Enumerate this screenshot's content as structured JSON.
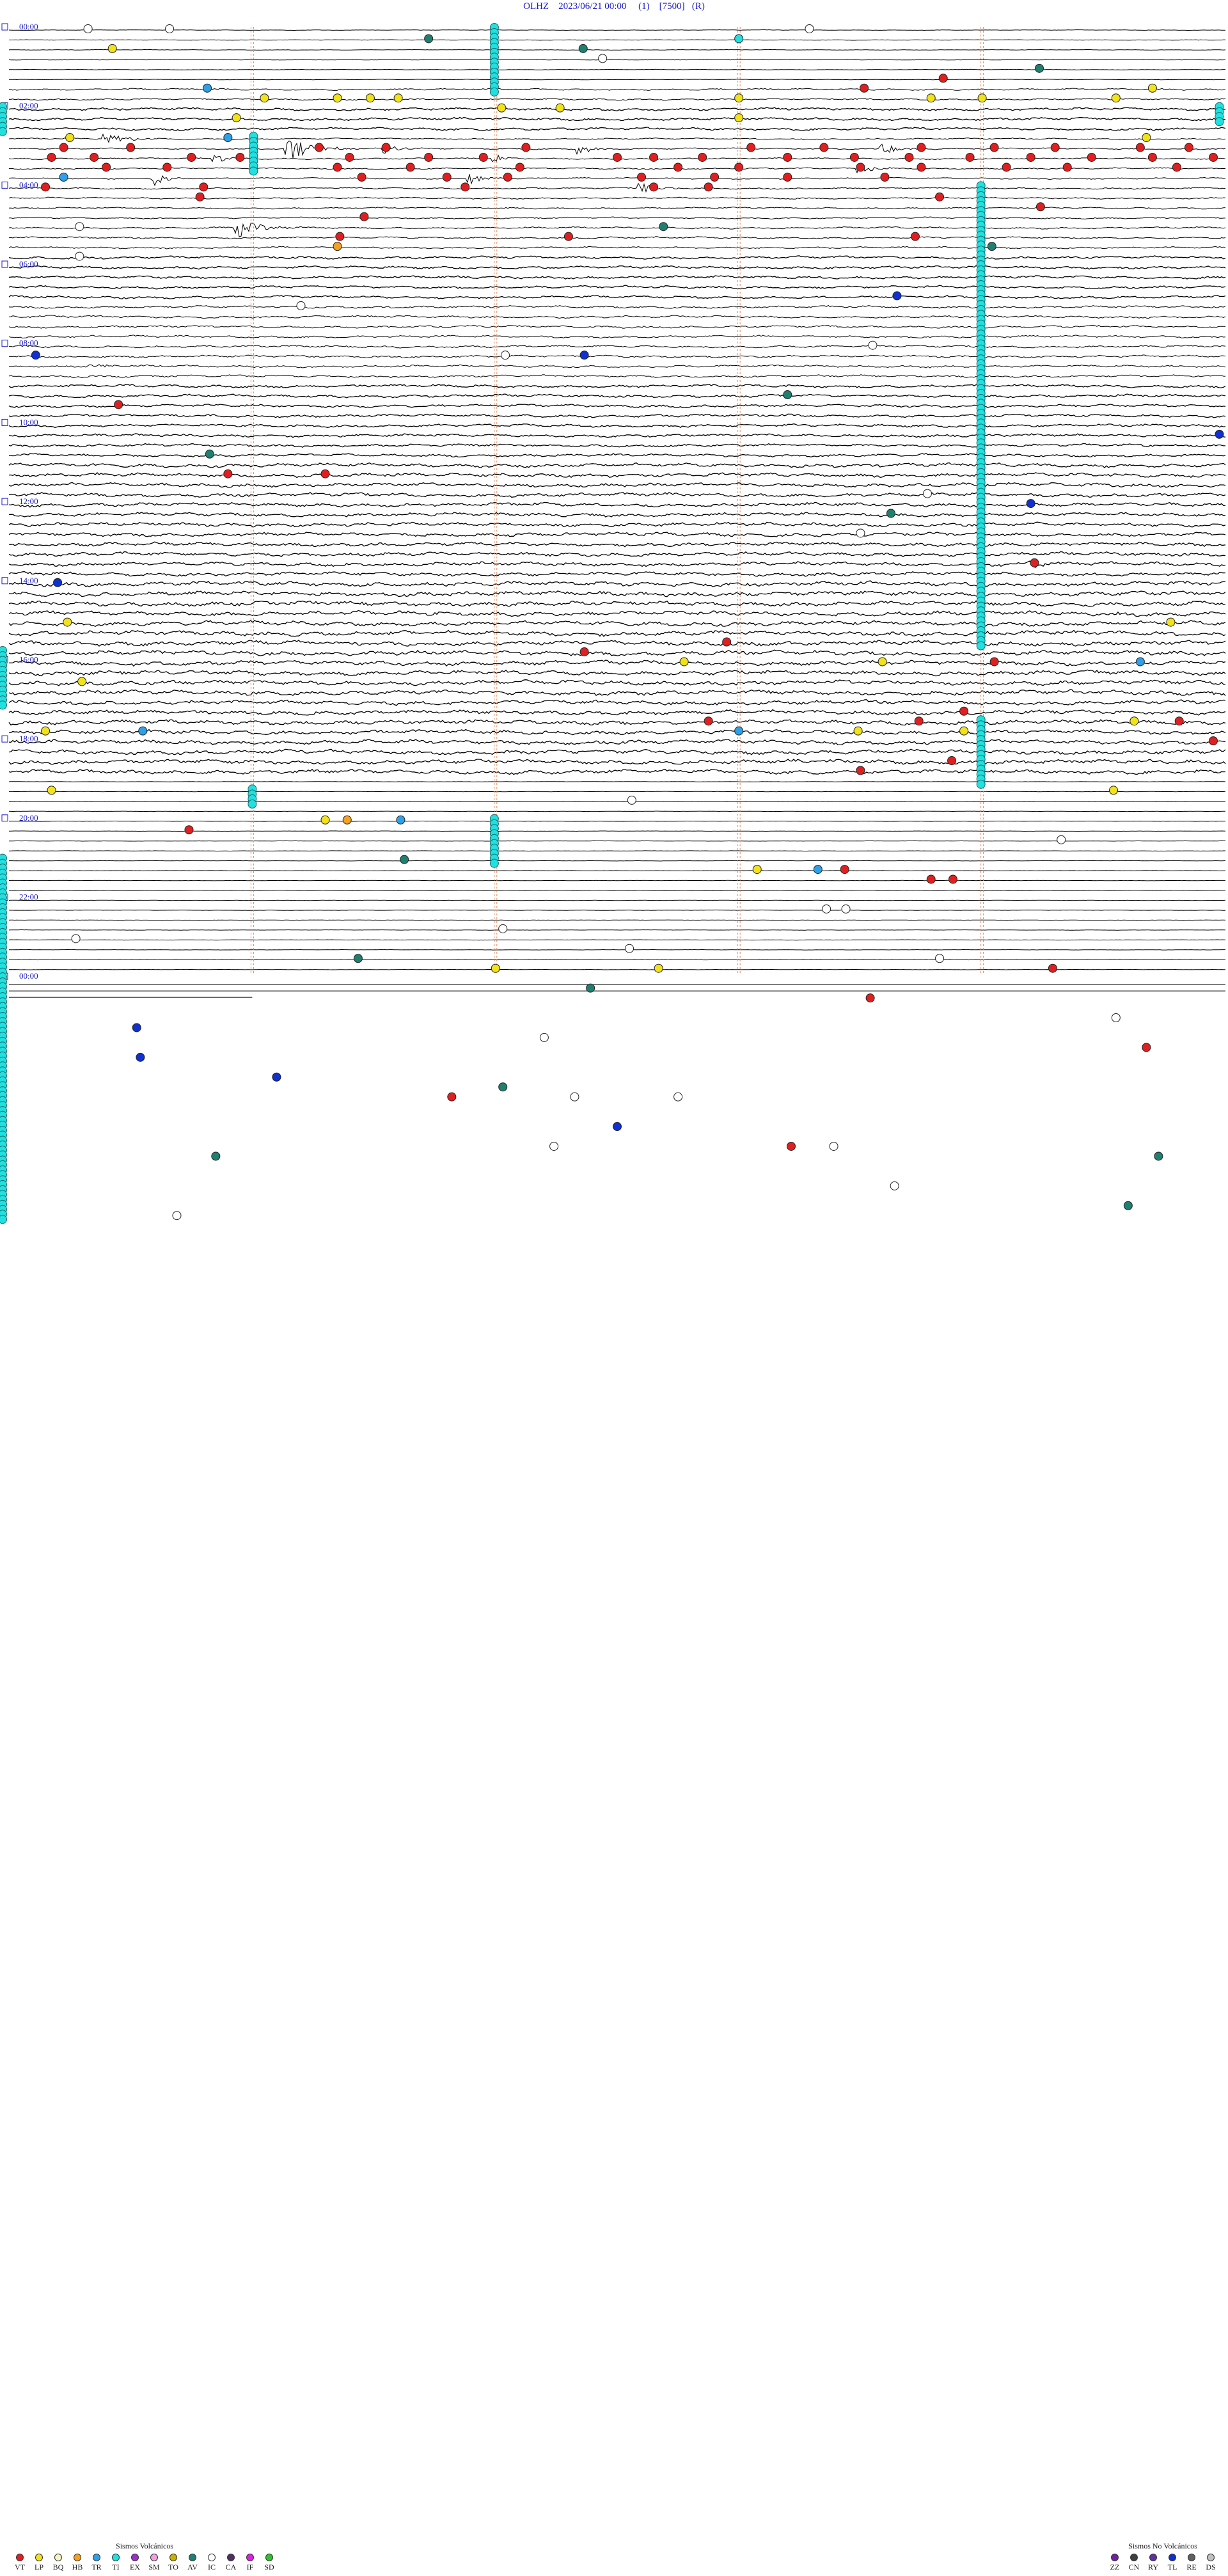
{
  "header": {
    "station": "OLHZ",
    "datetime": "2023/06/21 00:00",
    "run": "(1)",
    "scale": "[7500]",
    "flag": "(R)"
  },
  "colors": {
    "title_blue": "#1a1acc",
    "trace": "#000000",
    "marker_line": "#e8895a",
    "VT": "#e02020",
    "LP": "#f2e21a",
    "BQ": "#f7f4c0",
    "HB": "#f5a020",
    "TR": "#2ea0e8",
    "TI": "#20e0e0",
    "EX": "#9a30c8",
    "SM": "#f0a0e0",
    "TO": "#c8b000",
    "AV": "#208070",
    "IC": "#ffffff",
    "CA": "#503060",
    "IF": "#e020e0",
    "SD": "#30c030",
    "ZZ": "#7020a0",
    "CN": "#404040",
    "RY": "#6030a0",
    "TL": "#1030d0",
    "RE": "#606060",
    "DS": "#c0c0c0"
  },
  "chart_data": {
    "type": "seismogram-drum",
    "title": "OLHZ  2023/06/21 00:00  (1)  [7500]  (R)",
    "rows_per_hour": 4,
    "hours": 24,
    "hour_labels": [
      "00:00",
      "02:00",
      "04:00",
      "06:00",
      "08:00",
      "10:00",
      "12:00",
      "14:00",
      "16:00",
      "18:00",
      "20:00",
      "22:00",
      "00:00"
    ],
    "minute_marker_fractions": [
      0.2,
      0.4,
      0.6,
      0.8
    ],
    "noise_profile": [
      {
        "from": 0,
        "to": 6,
        "level": 0.3
      },
      {
        "from": 6,
        "to": 8,
        "level": 1.0
      },
      {
        "from": 8,
        "to": 11,
        "level": 1.6
      },
      {
        "from": 11,
        "to": 16,
        "level": 0.9
      },
      {
        "from": 16,
        "to": 20,
        "level": 1.0
      },
      {
        "from": 20,
        "to": 23,
        "level": 1.1
      },
      {
        "from": 23,
        "to": 28,
        "level": 1.6
      },
      {
        "from": 28,
        "to": 36,
        "level": 1.4
      },
      {
        "from": 36,
        "to": 44,
        "level": 1.7
      },
      {
        "from": 44,
        "to": 56,
        "level": 2.2
      },
      {
        "from": 56,
        "to": 68,
        "level": 2.7
      },
      {
        "from": 68,
        "to": 76,
        "level": 2.5
      },
      {
        "from": 76,
        "to": 96,
        "level": 0.2
      }
    ],
    "events": [
      {
        "row": 0,
        "t": 0.065,
        "c": "IC"
      },
      {
        "row": 0,
        "t": 0.132,
        "c": "IC"
      },
      {
        "row": 0,
        "t": 0.658,
        "c": "IC"
      },
      {
        "row": 1,
        "t": 0.345,
        "c": "AV"
      },
      {
        "row": 1,
        "t": 0.6,
        "c": "TI"
      },
      {
        "row": 2,
        "t": 0.085,
        "c": "LP"
      },
      {
        "row": 2,
        "t": 0.472,
        "c": "AV"
      },
      {
        "row": 3,
        "t": 0.488,
        "c": "IC"
      },
      {
        "row": 4,
        "t": 0.847,
        "c": "AV"
      },
      {
        "row": 5,
        "t": 0.768,
        "c": "VT"
      },
      {
        "row": 6,
        "t": 0.703,
        "c": "VT"
      },
      {
        "row": 6,
        "t": 0.163,
        "c": "TR"
      },
      {
        "row": 6,
        "t": 0.94,
        "c": "LP"
      },
      {
        "row": 7,
        "t": 0.21,
        "c": "LP"
      },
      {
        "row": 7,
        "t": 0.27,
        "c": "LP"
      },
      {
        "row": 7,
        "t": 0.297,
        "c": "LP"
      },
      {
        "row": 7,
        "t": 0.32,
        "c": "LP"
      },
      {
        "row": 7,
        "t": 0.6,
        "c": "LP"
      },
      {
        "row": 7,
        "t": 0.758,
        "c": "LP"
      },
      {
        "row": 7,
        "t": 0.8,
        "c": "LP"
      },
      {
        "row": 7,
        "t": 0.91,
        "c": "LP"
      },
      {
        "row": 8,
        "t": 0.405,
        "c": "LP"
      },
      {
        "row": 8,
        "t": 0.453,
        "c": "LP"
      },
      {
        "row": 9,
        "t": 0.187,
        "c": "LP"
      },
      {
        "row": 9,
        "t": 0.6,
        "c": "LP"
      },
      {
        "row": 11,
        "t": 0.935,
        "c": "LP"
      },
      {
        "row": 11,
        "t": 0.18,
        "c": "TR"
      },
      {
        "row": 11,
        "t": 0.05,
        "c": "LP"
      },
      {
        "row": 12,
        "t": 0.045,
        "c": "VT"
      },
      {
        "row": 12,
        "t": 0.1,
        "c": "VT"
      },
      {
        "row": 12,
        "t": 0.255,
        "c": "VT"
      },
      {
        "row": 12,
        "t": 0.31,
        "c": "VT"
      },
      {
        "row": 12,
        "t": 0.425,
        "c": "VT"
      },
      {
        "row": 12,
        "t": 0.61,
        "c": "VT"
      },
      {
        "row": 12,
        "t": 0.67,
        "c": "VT"
      },
      {
        "row": 12,
        "t": 0.75,
        "c": "VT"
      },
      {
        "row": 12,
        "t": 0.81,
        "c": "VT"
      },
      {
        "row": 12,
        "t": 0.86,
        "c": "VT"
      },
      {
        "row": 12,
        "t": 0.93,
        "c": "VT"
      },
      {
        "row": 12,
        "t": 0.97,
        "c": "VT"
      },
      {
        "row": 13,
        "t": 0.035,
        "c": "VT"
      },
      {
        "row": 13,
        "t": 0.07,
        "c": "VT"
      },
      {
        "row": 13,
        "t": 0.15,
        "c": "VT"
      },
      {
        "row": 13,
        "t": 0.19,
        "c": "VT"
      },
      {
        "row": 13,
        "t": 0.28,
        "c": "VT"
      },
      {
        "row": 13,
        "t": 0.345,
        "c": "VT"
      },
      {
        "row": 13,
        "t": 0.39,
        "c": "VT"
      },
      {
        "row": 13,
        "t": 0.5,
        "c": "VT"
      },
      {
        "row": 13,
        "t": 0.53,
        "c": "VT"
      },
      {
        "row": 13,
        "t": 0.57,
        "c": "VT"
      },
      {
        "row": 13,
        "t": 0.64,
        "c": "VT"
      },
      {
        "row": 13,
        "t": 0.695,
        "c": "VT"
      },
      {
        "row": 13,
        "t": 0.74,
        "c": "VT"
      },
      {
        "row": 13,
        "t": 0.79,
        "c": "VT"
      },
      {
        "row": 13,
        "t": 0.84,
        "c": "VT"
      },
      {
        "row": 13,
        "t": 0.89,
        "c": "VT"
      },
      {
        "row": 13,
        "t": 0.94,
        "c": "VT"
      },
      {
        "row": 13,
        "t": 0.99,
        "c": "VT"
      },
      {
        "row": 14,
        "t": 0.08,
        "c": "VT"
      },
      {
        "row": 14,
        "t": 0.13,
        "c": "VT"
      },
      {
        "row": 14,
        "t": 0.27,
        "c": "VT"
      },
      {
        "row": 14,
        "t": 0.33,
        "c": "VT"
      },
      {
        "row": 14,
        "t": 0.42,
        "c": "VT"
      },
      {
        "row": 14,
        "t": 0.55,
        "c": "VT"
      },
      {
        "row": 14,
        "t": 0.6,
        "c": "VT"
      },
      {
        "row": 14,
        "t": 0.7,
        "c": "VT"
      },
      {
        "row": 14,
        "t": 0.75,
        "c": "VT"
      },
      {
        "row": 14,
        "t": 0.82,
        "c": "VT"
      },
      {
        "row": 14,
        "t": 0.87,
        "c": "VT"
      },
      {
        "row": 14,
        "t": 0.96,
        "c": "VT"
      },
      {
        "row": 15,
        "t": 0.045,
        "c": "TR"
      },
      {
        "row": 15,
        "t": 0.29,
        "c": "VT"
      },
      {
        "row": 15,
        "t": 0.36,
        "c": "VT"
      },
      {
        "row": 15,
        "t": 0.41,
        "c": "VT"
      },
      {
        "row": 15,
        "t": 0.52,
        "c": "VT"
      },
      {
        "row": 15,
        "t": 0.58,
        "c": "VT"
      },
      {
        "row": 15,
        "t": 0.64,
        "c": "VT"
      },
      {
        "row": 15,
        "t": 0.72,
        "c": "VT"
      },
      {
        "row": 16,
        "t": 0.03,
        "c": "VT"
      },
      {
        "row": 16,
        "t": 0.16,
        "c": "VT"
      },
      {
        "row": 16,
        "t": 0.375,
        "c": "VT"
      },
      {
        "row": 16,
        "t": 0.53,
        "c": "VT"
      },
      {
        "row": 16,
        "t": 0.575,
        "c": "VT"
      },
      {
        "row": 17,
        "t": 0.157,
        "c": "VT"
      },
      {
        "row": 17,
        "t": 0.765,
        "c": "VT"
      },
      {
        "row": 18,
        "t": 0.848,
        "c": "VT"
      },
      {
        "row": 19,
        "t": 0.292,
        "c": "VT"
      },
      {
        "row": 20,
        "t": 0.058,
        "c": "IC"
      },
      {
        "row": 20,
        "t": 0.538,
        "c": "AV"
      },
      {
        "row": 21,
        "t": 0.272,
        "c": "VT"
      },
      {
        "row": 21,
        "t": 0.46,
        "c": "VT"
      },
      {
        "row": 21,
        "t": 0.745,
        "c": "VT"
      },
      {
        "row": 22,
        "t": 0.27,
        "c": "HB"
      },
      {
        "row": 22,
        "t": 0.808,
        "c": "AV"
      },
      {
        "row": 23,
        "t": 0.058,
        "c": "IC"
      },
      {
        "row": 27,
        "t": 0.73,
        "c": "TL"
      },
      {
        "row": 28,
        "t": 0.24,
        "c": "IC"
      },
      {
        "row": 32,
        "t": 0.71,
        "c": "IC"
      },
      {
        "row": 33,
        "t": 0.022,
        "c": "TL"
      },
      {
        "row": 33,
        "t": 0.408,
        "c": "IC"
      },
      {
        "row": 33,
        "t": 0.473,
        "c": "TL"
      },
      {
        "row": 37,
        "t": 0.64,
        "c": "AV"
      },
      {
        "row": 38,
        "t": 0.09,
        "c": "VT"
      },
      {
        "row": 41,
        "t": 0.995,
        "c": "TL"
      },
      {
        "row": 43,
        "t": 0.165,
        "c": "AV"
      },
      {
        "row": 45,
        "t": 0.18,
        "c": "VT"
      },
      {
        "row": 45,
        "t": 0.26,
        "c": "VT"
      },
      {
        "row": 47,
        "t": 0.755,
        "c": "IC"
      },
      {
        "row": 48,
        "t": 0.84,
        "c": "TL"
      },
      {
        "row": 49,
        "t": 0.725,
        "c": "AV"
      },
      {
        "row": 51,
        "t": 0.7,
        "c": "IC"
      },
      {
        "row": 54,
        "t": 0.843,
        "c": "VT"
      },
      {
        "row": 56,
        "t": 0.04,
        "c": "TL"
      },
      {
        "row": 60,
        "t": 0.048,
        "c": "LP"
      },
      {
        "row": 60,
        "t": 0.955,
        "c": "LP"
      },
      {
        "row": 62,
        "t": 0.59,
        "c": "VT"
      },
      {
        "row": 63,
        "t": 0.473,
        "c": "VT"
      },
      {
        "row": 64,
        "t": 0.555,
        "c": "LP"
      },
      {
        "row": 64,
        "t": 0.718,
        "c": "LP"
      },
      {
        "row": 64,
        "t": 0.81,
        "c": "VT"
      },
      {
        "row": 64,
        "t": 0.93,
        "c": "TR"
      },
      {
        "row": 66,
        "t": 0.06,
        "c": "LP"
      },
      {
        "row": 69,
        "t": 0.785,
        "c": "VT"
      },
      {
        "row": 70,
        "t": 0.575,
        "c": "VT"
      },
      {
        "row": 70,
        "t": 0.748,
        "c": "VT"
      },
      {
        "row": 70,
        "t": 0.925,
        "c": "LP"
      },
      {
        "row": 70,
        "t": 0.962,
        "c": "VT"
      },
      {
        "row": 71,
        "t": 0.03,
        "c": "LP"
      },
      {
        "row": 71,
        "t": 0.11,
        "c": "TR"
      },
      {
        "row": 71,
        "t": 0.6,
        "c": "TR"
      },
      {
        "row": 71,
        "t": 0.698,
        "c": "LP"
      },
      {
        "row": 71,
        "t": 0.785,
        "c": "LP"
      },
      {
        "row": 72,
        "t": 0.99,
        "c": "VT"
      },
      {
        "row": 74,
        "t": 0.775,
        "c": "VT"
      },
      {
        "row": 75,
        "t": 0.7,
        "c": "VT"
      },
      {
        "row": 77,
        "t": 0.908,
        "c": "LP"
      },
      {
        "row": 77,
        "t": 0.035,
        "c": "LP"
      },
      {
        "row": 78,
        "t": 0.512,
        "c": "IC"
      },
      {
        "row": 80,
        "t": 0.26,
        "c": "LP"
      },
      {
        "row": 80,
        "t": 0.278,
        "c": "HB"
      },
      {
        "row": 80,
        "t": 0.322,
        "c": "TR"
      },
      {
        "row": 81,
        "t": 0.148,
        "c": "VT"
      },
      {
        "row": 82,
        "t": 0.865,
        "c": "IC"
      },
      {
        "row": 84,
        "t": 0.325,
        "c": "AV"
      },
      {
        "row": 85,
        "t": 0.615,
        "c": "LP"
      },
      {
        "row": 85,
        "t": 0.665,
        "c": "TR"
      },
      {
        "row": 85,
        "t": 0.687,
        "c": "VT"
      },
      {
        "row": 86,
        "t": 0.758,
        "c": "VT"
      },
      {
        "row": 86,
        "t": 0.776,
        "c": "VT"
      },
      {
        "row": 89,
        "t": 0.672,
        "c": "IC"
      },
      {
        "row": 89,
        "t": 0.688,
        "c": "IC"
      },
      {
        "row": 91,
        "t": 0.406,
        "c": "IC"
      },
      {
        "row": 92,
        "t": 0.055,
        "c": "IC"
      },
      {
        "row": 93,
        "t": 0.51,
        "c": "IC"
      },
      {
        "row": 94,
        "t": 0.765,
        "c": "IC"
      },
      {
        "row": 94,
        "t": 0.287,
        "c": "AV"
      }
    ],
    "events_late": [
      {
        "row": 95,
        "t": 0.4,
        "c": "LP"
      },
      {
        "row": 95,
        "t": 0.534,
        "c": "LP"
      },
      {
        "row": 95,
        "t": 0.858,
        "c": "VT"
      },
      {
        "row": 97,
        "t": 0.478,
        "c": "AV"
      },
      {
        "row": 98,
        "t": 0.708,
        "c": "VT"
      },
      {
        "row": 100,
        "t": 0.91,
        "c": "IC"
      },
      {
        "row": 101,
        "t": 0.105,
        "c": "TL"
      },
      {
        "row": 102,
        "t": 0.44,
        "c": "IC"
      },
      {
        "row": 103,
        "t": 0.935,
        "c": "VT"
      },
      {
        "row": 104,
        "t": 0.108,
        "c": "TL"
      },
      {
        "row": 106,
        "t": 0.22,
        "c": "TL"
      },
      {
        "row": 107,
        "t": 0.406,
        "c": "AV"
      },
      {
        "row": 108,
        "t": 0.364,
        "c": "VT"
      },
      {
        "row": 108,
        "t": 0.465,
        "c": "IC"
      },
      {
        "row": 108,
        "t": 0.55,
        "c": "IC"
      },
      {
        "row": 111,
        "t": 0.5,
        "c": "TL"
      },
      {
        "row": 113,
        "t": 0.643,
        "c": "VT"
      },
      {
        "row": 113,
        "t": 0.448,
        "c": "IC"
      },
      {
        "row": 113,
        "t": 0.678,
        "c": "IC"
      },
      {
        "row": 114,
        "t": 0.17,
        "c": "AV"
      },
      {
        "row": 114,
        "t": 0.945,
        "c": "AV"
      },
      {
        "row": 117,
        "t": 0.728,
        "c": "IC"
      },
      {
        "row": 119,
        "t": 0.92,
        "c": "AV"
      },
      {
        "row": 120,
        "t": 0.138,
        "c": "IC"
      }
    ],
    "ti_columns": [
      {
        "t": 0.399,
        "from_row": 0,
        "to_row": 6
      },
      {
        "t": 0.201,
        "from_row": 11,
        "to_row": 14
      },
      {
        "t": 0.799,
        "from_row": 16,
        "to_row": 62
      },
      {
        "t": 0.799,
        "from_row": 70,
        "to_row": 76
      },
      {
        "t": 0.2,
        "from_row": 77,
        "to_row": 78
      },
      {
        "t": 0.399,
        "from_row": 80,
        "to_row": 84
      },
      {
        "t": 0.0,
        "from_row": 8,
        "to_row": 10
      },
      {
        "t": 0.0,
        "from_row": 63,
        "to_row": 68
      },
      {
        "t": 0.0,
        "from_row": 84,
        "to_row": 120
      },
      {
        "t": 0.995,
        "from_row": 8,
        "to_row": 9
      }
    ],
    "bursts": [
      {
        "row": 12,
        "t": 0.23,
        "w": 0.05,
        "amp": 3.2
      },
      {
        "row": 11,
        "t": 0.08,
        "w": 0.05,
        "amp": 1.2
      },
      {
        "row": 12,
        "t": 0.31,
        "w": 0.03,
        "amp": 1.5
      },
      {
        "row": 12,
        "t": 0.47,
        "w": 0.03,
        "amp": 1.4
      },
      {
        "row": 12,
        "t": 0.72,
        "w": 0.03,
        "amp": 1.4
      },
      {
        "row": 13,
        "t": 0.17,
        "w": 0.03,
        "amp": 1.0
      },
      {
        "row": 13,
        "t": 0.4,
        "w": 0.02,
        "amp": 1.0
      },
      {
        "row": 14,
        "t": 0.7,
        "w": 0.03,
        "amp": 1.5
      },
      {
        "row": 15,
        "t": 0.12,
        "w": 0.03,
        "amp": 1.8
      },
      {
        "row": 15,
        "t": 0.38,
        "w": 0.03,
        "amp": 1.6
      },
      {
        "row": 16,
        "t": 0.52,
        "w": 0.03,
        "amp": 1.6
      },
      {
        "row": 20,
        "t": 0.19,
        "w": 0.05,
        "amp": 2.2
      },
      {
        "row": 34,
        "t": 0.07,
        "w": 0.05,
        "amp": 0.6
      },
      {
        "row": 54,
        "t": 0.84,
        "w": 0.04,
        "amp": 0.9
      },
      {
        "row": 104,
        "t": 0.17,
        "w": 0.08,
        "amp": 0.6
      }
    ]
  },
  "legend": {
    "volcanic_title": "Sismos Volcánicos",
    "volcanic": [
      "VT",
      "LP",
      "BQ",
      "HB",
      "TR",
      "TI",
      "EX",
      "SM",
      "TO",
      "AV",
      "IC",
      "CA",
      "IF",
      "SD"
    ],
    "non_volcanic_title": "Sismos No Volcánicos",
    "non_volcanic": [
      "ZZ",
      "CN",
      "RY",
      "TL",
      "RE",
      "DS"
    ]
  }
}
